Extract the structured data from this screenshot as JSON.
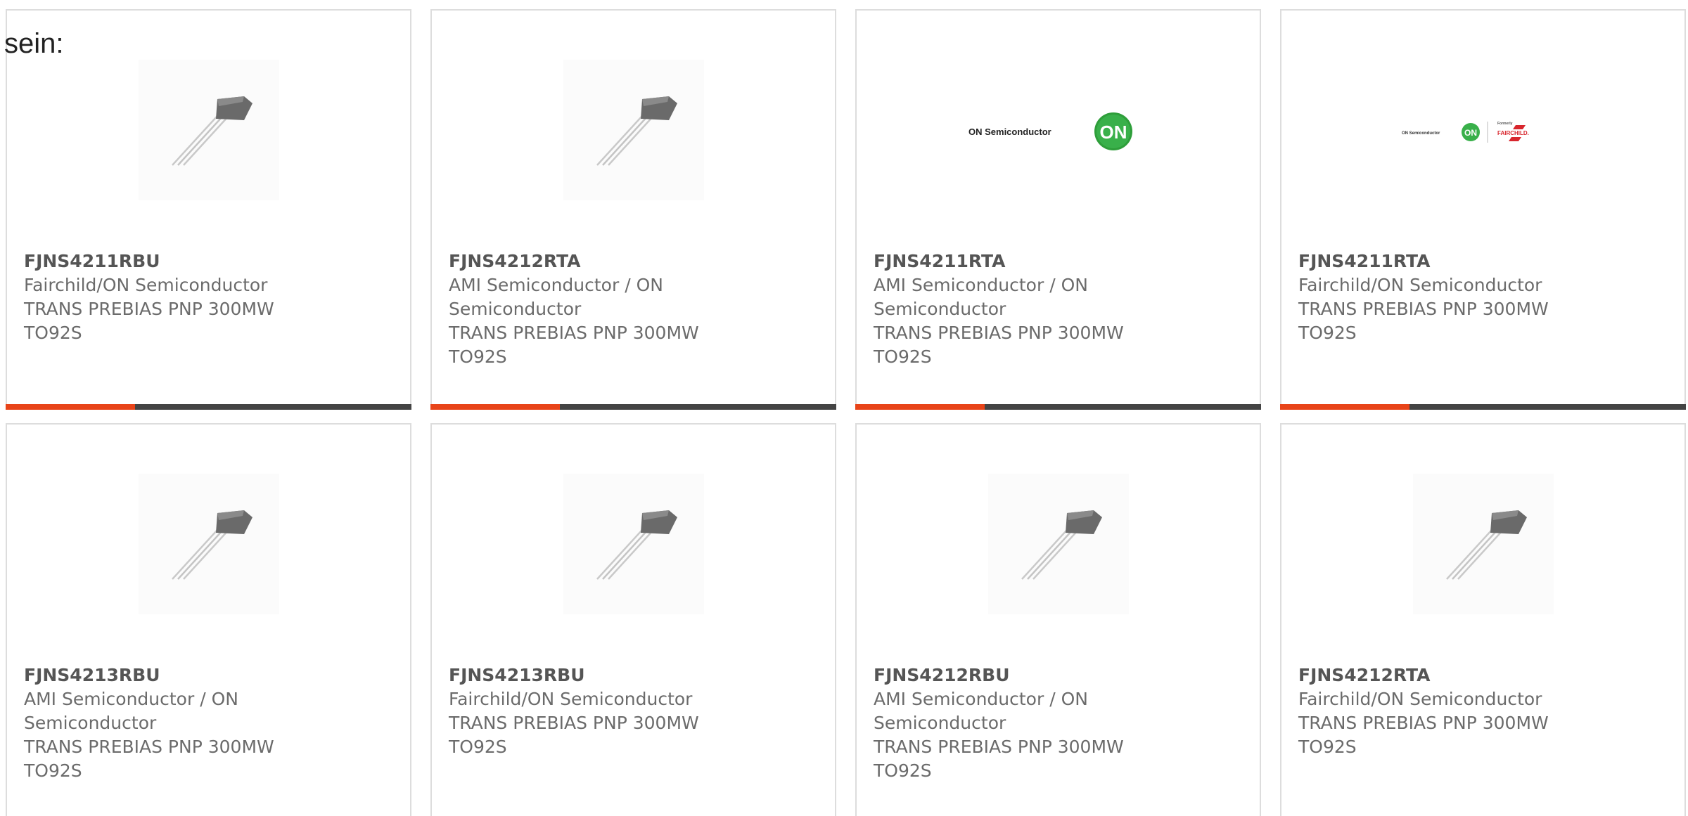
{
  "intro_text": "sein:",
  "colors": {
    "accent": "#e84419",
    "bar": "#444444",
    "on_green": "#2e9e3a",
    "fairchild_red": "#d8262d"
  },
  "products": [
    {
      "part_number": "FJNS4211RBU",
      "manufacturer": "Fairchild/ON Semiconductor",
      "description": "TRANS PREBIAS PNP 300MW TO92S",
      "image": "to92-transistor-image"
    },
    {
      "part_number": "FJNS4212RTA",
      "manufacturer": "AMI Semiconductor / ON Semiconductor",
      "description": "TRANS PREBIAS PNP 300MW TO92S",
      "image": "to92-transistor-image"
    },
    {
      "part_number": "FJNS4211RTA",
      "manufacturer": "AMI Semiconductor / ON Semiconductor",
      "description": "TRANS PREBIAS PNP 300MW TO92S",
      "image": "on-semiconductor-logo",
      "logo_text": "ON Semiconductor",
      "logo_badge": "ON"
    },
    {
      "part_number": "FJNS4211RTA",
      "manufacturer": "Fairchild/ON Semiconductor",
      "description": "TRANS PREBIAS PNP 300MW TO92S",
      "image": "on-fairchild-logo",
      "logo_text": "ON Semiconductor",
      "logo_badge": "ON",
      "logo_formerly": "Formerly",
      "logo_brand": "FAIRCHILD."
    },
    {
      "part_number": "FJNS4213RBU",
      "manufacturer": "AMI Semiconductor / ON Semiconductor",
      "description": "TRANS PREBIAS PNP 300MW TO92S",
      "image": "to92-transistor-image"
    },
    {
      "part_number": "FJNS4213RBU",
      "manufacturer": "Fairchild/ON Semiconductor",
      "description": "TRANS PREBIAS PNP 300MW TO92S",
      "image": "to92-transistor-image"
    },
    {
      "part_number": "FJNS4212RBU",
      "manufacturer": "AMI Semiconductor / ON Semiconductor",
      "description": "TRANS PREBIAS PNP 300MW TO92S",
      "image": "to92-transistor-image"
    },
    {
      "part_number": "FJNS4212RTA",
      "manufacturer": "Fairchild/ON Semiconductor",
      "description": "TRANS PREBIAS PNP 300MW TO92S",
      "image": "to92-transistor-image"
    }
  ]
}
